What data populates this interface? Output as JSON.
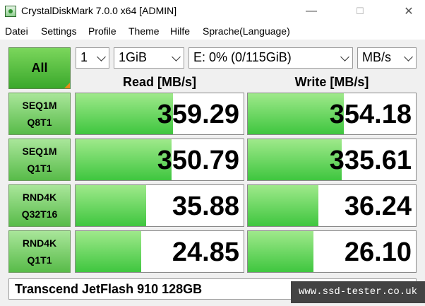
{
  "window": {
    "title": "CrystalDiskMark 7.0.0 x64 [ADMIN]",
    "minimize_glyph": "—",
    "maximize_glyph": "☐",
    "close_glyph": "✕"
  },
  "menu": [
    "Datei",
    "Settings",
    "Profile",
    "Theme",
    "Hilfe",
    "Sprache(Language)"
  ],
  "controls": {
    "all_label": "All",
    "count": "1",
    "size": "1GiB",
    "drive": "E: 0% (0/115GiB)",
    "unit": "MB/s"
  },
  "headers": {
    "read": "Read [MB/s]",
    "write": "Write [MB/s]"
  },
  "tests": [
    {
      "line1": "SEQ1M",
      "line2": "Q8T1",
      "read": "359.29",
      "write": "354.18",
      "read_fill": 0.58,
      "write_fill": 0.57
    },
    {
      "line1": "SEQ1M",
      "line2": "Q1T1",
      "read": "350.79",
      "write": "335.61",
      "read_fill": 0.57,
      "write_fill": 0.56
    },
    {
      "line1": "RND4K",
      "line2": "Q32T16",
      "read": "35.88",
      "write": "36.24",
      "read_fill": 0.42,
      "write_fill": 0.42
    },
    {
      "line1": "RND4K",
      "line2": "Q1T1",
      "read": "24.85",
      "write": "26.10",
      "read_fill": 0.39,
      "write_fill": 0.39
    }
  ],
  "drive_name": "Transcend JetFlash 910 128GB",
  "watermark": "www.ssd-tester.co.uk",
  "colors": {
    "button_green": "#58bb49",
    "bar_green": "#3fc63f",
    "watermark_bg": "#434343"
  }
}
